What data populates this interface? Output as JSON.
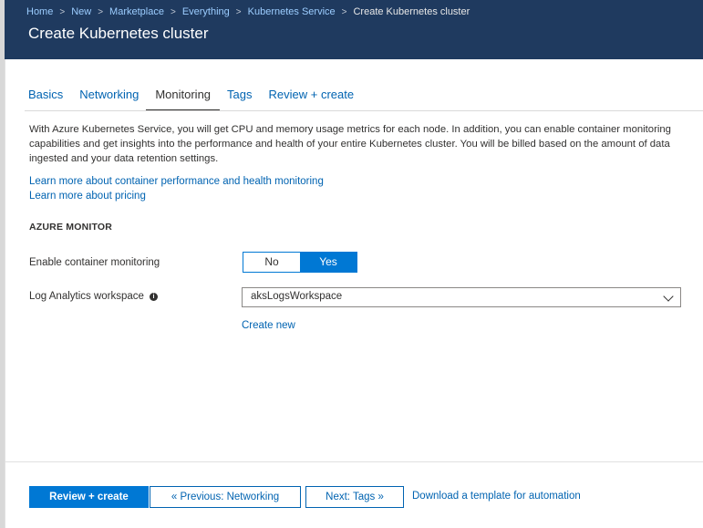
{
  "header": {
    "breadcrumbs": [
      "Home",
      "New",
      "Marketplace",
      "Everything",
      "Kubernetes Service"
    ],
    "breadcrumb_current": "Create Kubernetes cluster",
    "title": "Create Kubernetes cluster"
  },
  "tabs": [
    "Basics",
    "Networking",
    "Monitoring",
    "Tags",
    "Review + create"
  ],
  "active_tab": "Monitoring",
  "intro": "With Azure Kubernetes Service, you will get CPU and memory usage metrics for each node. In addition, you can enable container monitoring capabilities and get insights into the performance and health of your entire Kubernetes cluster. You will be billed based on the amount of data ingested and your data retention settings.",
  "links": {
    "learn_monitoring": "Learn more about container performance and health monitoring",
    "learn_pricing": "Learn more about pricing"
  },
  "section": {
    "heading": "AZURE MONITOR",
    "monitoring_label": "Enable container monitoring",
    "toggle_no": "No",
    "toggle_yes": "Yes",
    "toggle_selected": "Yes",
    "workspace_label": "Log Analytics workspace",
    "workspace_value": "aksLogsWorkspace",
    "create_new": "Create new"
  },
  "footer": {
    "review_create": "Review + create",
    "previous": "« Previous: Networking",
    "next": "Next: Tags »",
    "download": "Download a template for automation"
  },
  "colors": {
    "header_bg": "#1f3a5f",
    "accent": "#0078d4",
    "link": "#0063b1"
  }
}
